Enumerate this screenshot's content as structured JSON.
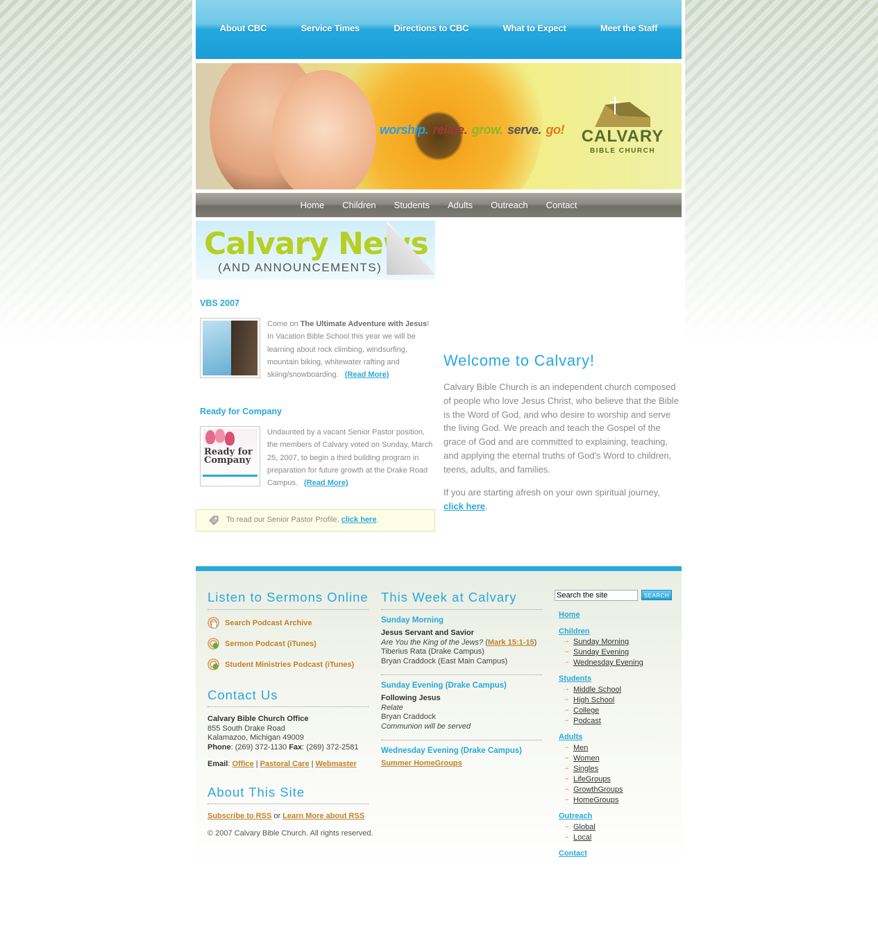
{
  "top_nav": [
    "About CBC",
    "Service Times",
    "Directions to CBC",
    "What to Expect",
    "Meet the Staff"
  ],
  "banner": {
    "tagline": [
      {
        "text": "worship.",
        "color": "#2aa2dc"
      },
      {
        "text": "relate.",
        "color": "#9a3b3b"
      },
      {
        "text": "grow.",
        "color": "#8bb82a"
      },
      {
        "text": "serve.",
        "color": "#555555"
      },
      {
        "text": "go!",
        "color": "#e07a1a"
      }
    ],
    "logo_name": "CALVARY",
    "logo_sub": "BIBLE CHURCH"
  },
  "sub_nav": [
    "Home",
    "Children",
    "Students",
    "Adults",
    "Outreach",
    "Contact"
  ],
  "news": {
    "header_big": "Calvary News",
    "header_small": "(AND ANNOUNCEMENTS)",
    "items": [
      {
        "title": "VBS 2007",
        "text_pre": "Come on ",
        "text_bold": "The Ultimate Adventure with Jesus",
        "text_post": "! In Vacation Bible School this year we will be learning about rock climbing, windsurfing, mountain biking, whitewater rafting and skiing/snowboarding.",
        "read_more": "(Read More)"
      },
      {
        "title": "Ready for Company",
        "text_pre": "Undaunted by a vacant Senior Pastor position, the members of Calvary voted on Sunday, March 25, 2007, to begin a third building program in preparation for future growth at the Drake Road Campus.",
        "text_bold": "",
        "text_post": "",
        "read_more": "(Read More)",
        "thumb_label": "Ready for Company"
      }
    ],
    "profile_text": "To read our Senior Pastor Profile, ",
    "profile_link": "click here",
    "profile_end": "."
  },
  "welcome": {
    "title": "Welcome to Calvary!",
    "body": "Calvary Bible Church is an independent church composed of people who love Jesus Christ, who believe that the Bible is the Word of God, and who desire to worship and serve the living God. We preach and teach the Gospel of the grace of God and are committed to explaining, teaching, and applying the eternal truths of God's Word to children, teens, adults, and families.",
    "body2": "If you are starting afresh on your own spiritual journey,",
    "link": "click here",
    "link_end": "."
  },
  "sermons": {
    "title": "Listen to Sermons Online",
    "items": [
      "Search Podcast Archive",
      "Sermon Podcast (iTunes)",
      "Student Ministries Podcast (iTunes)"
    ]
  },
  "contact": {
    "title": "Contact Us",
    "office": "Calvary Bible Church Office",
    "address1": "855 South Drake Road",
    "address2": "Kalamazoo, Michigan 49009",
    "phone_label": "Phone",
    "phone": ": (269) 372-1130 ",
    "fax_label": "Fax",
    "fax": ": (269) 372-2581",
    "email_label": "Email",
    "email_links": [
      "Office",
      "Pastoral Care",
      "Webmaster"
    ]
  },
  "about": {
    "title": "About This Site",
    "rss1": "Subscribe to RSS",
    "or": " or ",
    "rss2": "Learn More about RSS",
    "copyright": "© 2007 Calvary Bible Church. All rights reserved."
  },
  "week": {
    "title": "This Week at Calvary",
    "sunday_morning": {
      "heading": "Sunday Morning",
      "series": "Jesus Servant and Savior",
      "sermon": "Are You the King of the Jews?",
      "open_paren": " (",
      "ref": "Mark 15:1-15",
      "close_paren": ")",
      "speaker1": "Tiberius Rata (Drake Campus)",
      "speaker2": "Bryan Craddock (East Main Campus)"
    },
    "sunday_evening": {
      "heading": "Sunday Evening (Drake Campus)",
      "series": "Following Jesus",
      "sermon": "Relate",
      "speaker": "Bryan Craddock",
      "note": "Communion will be served"
    },
    "wednesday": {
      "heading": "Wednesday Evening (Drake Campus)",
      "item": "Summer HomeGroups"
    }
  },
  "search": {
    "placeholder": "Search the site",
    "button": "SEARCH"
  },
  "right_nav": {
    "home": "Home",
    "children": {
      "label": "Children",
      "items": [
        "Sunday Morning",
        "Sunday Evening",
        "Wednesday Evening"
      ]
    },
    "students": {
      "label": "Students",
      "items": [
        "Middle School",
        "High School",
        "College",
        "Podcast"
      ]
    },
    "adults": {
      "label": "Adults",
      "items": [
        "Men",
        "Women",
        "Singles",
        "LifeGroups",
        "GrowthGroups",
        "HomeGroups"
      ]
    },
    "outreach": {
      "label": "Outreach",
      "items": [
        "Global",
        "Local"
      ]
    },
    "contact": "Contact"
  }
}
